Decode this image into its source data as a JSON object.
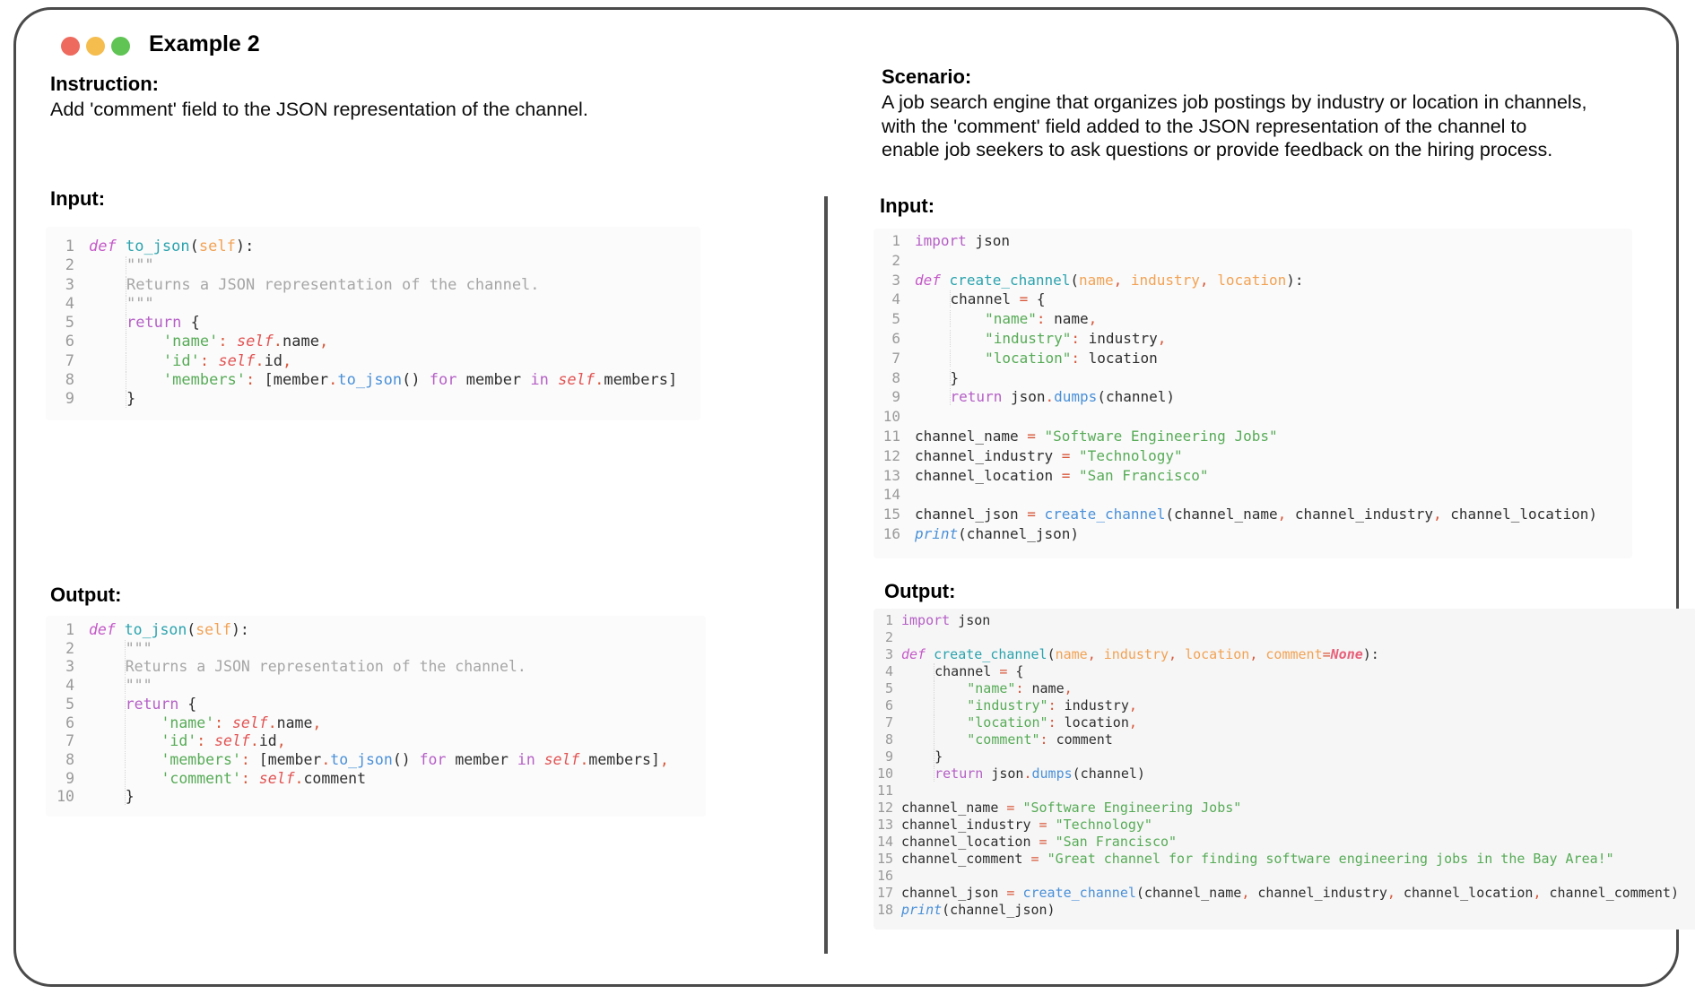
{
  "window": {
    "title": "Example 2"
  },
  "colors": {
    "frame_border": "#4a4a4a",
    "dot_red": "#ee6a5e",
    "dot_yellow": "#f4bd4e",
    "dot_green": "#5fc454",
    "syntax_keyword": "#b55fc6",
    "syntax_function_def": "#2ba3ae",
    "syntax_function_call": "#4a90d8",
    "syntax_string": "#57ab57",
    "syntax_param": "#f2a254",
    "syntax_self": "#e25353",
    "syntax_operator": "#d8573a",
    "syntax_docstring": "#a6a6a6",
    "line_number": "#9a9a9a"
  },
  "left": {
    "instruction_label": "Instruction:",
    "instruction_text": "Add 'comment' field to the JSON representation of the channel.",
    "input_label": "Input:",
    "output_label": "Output:",
    "input_code": {
      "lines": [
        [
          [
            "def",
            "kwI"
          ],
          [
            " "
          ],
          [
            "to_json",
            "fn"
          ],
          [
            "("
          ],
          [
            "self",
            "par"
          ],
          [
            "):"
          ]
        ],
        [
          [
            "    ",
            "ind"
          ],
          [
            "\"\"\"",
            "doc"
          ]
        ],
        [
          [
            "    ",
            "ind"
          ],
          [
            "Returns a JSON representation of the channel.",
            "doc"
          ]
        ],
        [
          [
            "    ",
            "ind"
          ],
          [
            "\"\"\"",
            "doc"
          ]
        ],
        [
          [
            "    ",
            "ind"
          ],
          [
            "return",
            "kw"
          ],
          [
            " {"
          ]
        ],
        [
          [
            "    ",
            "ind"
          ],
          [
            "    "
          ],
          [
            "'name'",
            "str"
          ],
          [
            ":",
            "op"
          ],
          [
            " "
          ],
          [
            "self",
            "slf"
          ],
          [
            ".",
            "op"
          ],
          [
            "name"
          ],
          [
            ",",
            "op"
          ]
        ],
        [
          [
            "    ",
            "ind"
          ],
          [
            "    "
          ],
          [
            "'id'",
            "str"
          ],
          [
            ":",
            "op"
          ],
          [
            " "
          ],
          [
            "self",
            "slf"
          ],
          [
            ".",
            "op"
          ],
          [
            "id"
          ],
          [
            ",",
            "op"
          ]
        ],
        [
          [
            "    ",
            "ind"
          ],
          [
            "    "
          ],
          [
            "'members'",
            "str"
          ],
          [
            ":",
            "op"
          ],
          [
            " [member"
          ],
          [
            ".",
            "op"
          ],
          [
            "to_json",
            "call"
          ],
          [
            "() "
          ],
          [
            "for",
            "kw"
          ],
          [
            " member "
          ],
          [
            "in",
            "kw"
          ],
          [
            " "
          ],
          [
            "self",
            "slf"
          ],
          [
            ".",
            "op"
          ],
          [
            "members]"
          ]
        ],
        [
          [
            "    ",
            "ind"
          ],
          [
            "}"
          ]
        ]
      ]
    },
    "output_code": {
      "lines": [
        [
          [
            "def",
            "kwI"
          ],
          [
            " "
          ],
          [
            "to_json",
            "fn"
          ],
          [
            "("
          ],
          [
            "self",
            "par"
          ],
          [
            "):"
          ]
        ],
        [
          [
            "    ",
            "ind"
          ],
          [
            "\"\"\"",
            "doc"
          ]
        ],
        [
          [
            "    ",
            "ind"
          ],
          [
            "Returns a JSON representation of the channel.",
            "doc"
          ]
        ],
        [
          [
            "    ",
            "ind"
          ],
          [
            "\"\"\"",
            "doc"
          ]
        ],
        [
          [
            "    ",
            "ind"
          ],
          [
            "return",
            "kw"
          ],
          [
            " {"
          ]
        ],
        [
          [
            "    ",
            "ind"
          ],
          [
            "    "
          ],
          [
            "'name'",
            "str"
          ],
          [
            ":",
            "op"
          ],
          [
            " "
          ],
          [
            "self",
            "slf"
          ],
          [
            ".",
            "op"
          ],
          [
            "name"
          ],
          [
            ",",
            "op"
          ]
        ],
        [
          [
            "    ",
            "ind"
          ],
          [
            "    "
          ],
          [
            "'id'",
            "str"
          ],
          [
            ":",
            "op"
          ],
          [
            " "
          ],
          [
            "self",
            "slf"
          ],
          [
            ".",
            "op"
          ],
          [
            "id"
          ],
          [
            ",",
            "op"
          ]
        ],
        [
          [
            "    ",
            "ind"
          ],
          [
            "    "
          ],
          [
            "'members'",
            "str"
          ],
          [
            ":",
            "op"
          ],
          [
            " [member"
          ],
          [
            ".",
            "op"
          ],
          [
            "to_json",
            "call"
          ],
          [
            "() "
          ],
          [
            "for",
            "kw"
          ],
          [
            " member "
          ],
          [
            "in",
            "kw"
          ],
          [
            " "
          ],
          [
            "self",
            "slf"
          ],
          [
            ".",
            "op"
          ],
          [
            "members]"
          ],
          [
            ",",
            "op"
          ]
        ],
        [
          [
            "    ",
            "ind"
          ],
          [
            "    "
          ],
          [
            "'comment'",
            "str"
          ],
          [
            ":",
            "op"
          ],
          [
            " "
          ],
          [
            "self",
            "slf"
          ],
          [
            ".",
            "op"
          ],
          [
            "comment"
          ]
        ],
        [
          [
            "    ",
            "ind"
          ],
          [
            "}"
          ]
        ]
      ]
    }
  },
  "right": {
    "scenario_label": "Scenario:",
    "scenario_text": "A job search engine that organizes job postings by industry or location in channels,\nwith the 'comment' field added to the JSON representation of the channel to\nenable job seekers to ask questions or provide feedback on the hiring process.",
    "input_label": "Input:",
    "output_label": "Output:",
    "input_code": {
      "lines": [
        [
          [
            "import",
            "kw"
          ],
          [
            " json"
          ]
        ],
        [],
        [
          [
            "def",
            "kwI"
          ],
          [
            " "
          ],
          [
            "create_channel",
            "fn"
          ],
          [
            "("
          ],
          [
            "name",
            "par"
          ],
          [
            ",",
            "op"
          ],
          [
            " "
          ],
          [
            "industry",
            "par"
          ],
          [
            ",",
            "op"
          ],
          [
            " "
          ],
          [
            "location",
            "par"
          ],
          [
            "):"
          ]
        ],
        [
          [
            "    ",
            "ind"
          ],
          [
            "channel "
          ],
          [
            "=",
            "op"
          ],
          [
            " {"
          ]
        ],
        [
          [
            "    ",
            "ind"
          ],
          [
            "    "
          ],
          [
            "\"name\"",
            "str"
          ],
          [
            ":",
            "op"
          ],
          [
            " name"
          ],
          [
            ",",
            "op"
          ]
        ],
        [
          [
            "    ",
            "ind"
          ],
          [
            "    "
          ],
          [
            "\"industry\"",
            "str"
          ],
          [
            ":",
            "op"
          ],
          [
            " industry"
          ],
          [
            ",",
            "op"
          ]
        ],
        [
          [
            "    ",
            "ind"
          ],
          [
            "    "
          ],
          [
            "\"location\"",
            "str"
          ],
          [
            ":",
            "op"
          ],
          [
            " location"
          ]
        ],
        [
          [
            "    ",
            "ind"
          ],
          [
            "}"
          ]
        ],
        [
          [
            "    ",
            "ind"
          ],
          [
            "return",
            "kw"
          ],
          [
            " json"
          ],
          [
            ".",
            "op"
          ],
          [
            "dumps",
            "call"
          ],
          [
            "(channel)"
          ]
        ],
        [],
        [
          [
            "channel_name "
          ],
          [
            "=",
            "op"
          ],
          [
            " "
          ],
          [
            "\"Software Engineering Jobs\"",
            "str"
          ]
        ],
        [
          [
            "channel_industry "
          ],
          [
            "=",
            "op"
          ],
          [
            " "
          ],
          [
            "\"Technology\"",
            "str"
          ]
        ],
        [
          [
            "channel_location "
          ],
          [
            "=",
            "op"
          ],
          [
            " "
          ],
          [
            "\"San Francisco\"",
            "str"
          ]
        ],
        [],
        [
          [
            "channel_json "
          ],
          [
            "=",
            "op"
          ],
          [
            " "
          ],
          [
            "create_channel",
            "call"
          ],
          [
            "(channel_name"
          ],
          [
            ",",
            "op"
          ],
          [
            " channel_industry"
          ],
          [
            ",",
            "op"
          ],
          [
            " channel_location)"
          ]
        ],
        [
          [
            "print",
            "bi"
          ],
          [
            "(channel_json)"
          ]
        ]
      ]
    },
    "output_code": {
      "lines": [
        [
          [
            "import",
            "kw"
          ],
          [
            " json"
          ]
        ],
        [],
        [
          [
            "def",
            "kwI"
          ],
          [
            " "
          ],
          [
            "create_channel",
            "fn"
          ],
          [
            "("
          ],
          [
            "name",
            "par"
          ],
          [
            ",",
            "op"
          ],
          [
            " "
          ],
          [
            "industry",
            "par"
          ],
          [
            ",",
            "op"
          ],
          [
            " "
          ],
          [
            "location",
            "par"
          ],
          [
            ",",
            "op"
          ],
          [
            " "
          ],
          [
            "comment",
            "par"
          ],
          [
            "=",
            "op"
          ],
          [
            "None",
            "non"
          ],
          [
            "):"
          ]
        ],
        [
          [
            "    ",
            "ind"
          ],
          [
            "channel "
          ],
          [
            "=",
            "op"
          ],
          [
            " {"
          ]
        ],
        [
          [
            "    ",
            "ind"
          ],
          [
            "    "
          ],
          [
            "\"name\"",
            "str"
          ],
          [
            ":",
            "op"
          ],
          [
            " name"
          ],
          [
            ",",
            "op"
          ]
        ],
        [
          [
            "    ",
            "ind"
          ],
          [
            "    "
          ],
          [
            "\"industry\"",
            "str"
          ],
          [
            ":",
            "op"
          ],
          [
            " industry"
          ],
          [
            ",",
            "op"
          ]
        ],
        [
          [
            "    ",
            "ind"
          ],
          [
            "    "
          ],
          [
            "\"location\"",
            "str"
          ],
          [
            ":",
            "op"
          ],
          [
            " location"
          ],
          [
            ",",
            "op"
          ]
        ],
        [
          [
            "    ",
            "ind"
          ],
          [
            "    "
          ],
          [
            "\"comment\"",
            "str"
          ],
          [
            ":",
            "op"
          ],
          [
            " comment"
          ]
        ],
        [
          [
            "    ",
            "ind"
          ],
          [
            "}"
          ]
        ],
        [
          [
            "    ",
            "ind"
          ],
          [
            "return",
            "kw"
          ],
          [
            " json"
          ],
          [
            ".",
            "op"
          ],
          [
            "dumps",
            "call"
          ],
          [
            "(channel)"
          ]
        ],
        [],
        [
          [
            "channel_name "
          ],
          [
            "=",
            "op"
          ],
          [
            " "
          ],
          [
            "\"Software Engineering Jobs\"",
            "str"
          ]
        ],
        [
          [
            "channel_industry "
          ],
          [
            "=",
            "op"
          ],
          [
            " "
          ],
          [
            "\"Technology\"",
            "str"
          ]
        ],
        [
          [
            "channel_location "
          ],
          [
            "=",
            "op"
          ],
          [
            " "
          ],
          [
            "\"San Francisco\"",
            "str"
          ]
        ],
        [
          [
            "channel_comment "
          ],
          [
            "=",
            "op"
          ],
          [
            " "
          ],
          [
            "\"Great channel for finding software engineering jobs in the Bay Area!\"",
            "str"
          ]
        ],
        [],
        [
          [
            "channel_json "
          ],
          [
            "=",
            "op"
          ],
          [
            " "
          ],
          [
            "create_channel",
            "call"
          ],
          [
            "(channel_name"
          ],
          [
            ",",
            "op"
          ],
          [
            " channel_industry"
          ],
          [
            ",",
            "op"
          ],
          [
            " channel_location"
          ],
          [
            ",",
            "op"
          ],
          [
            " channel_comment)"
          ]
        ],
        [
          [
            "print",
            "bi"
          ],
          [
            "(channel_json)"
          ]
        ]
      ]
    }
  }
}
